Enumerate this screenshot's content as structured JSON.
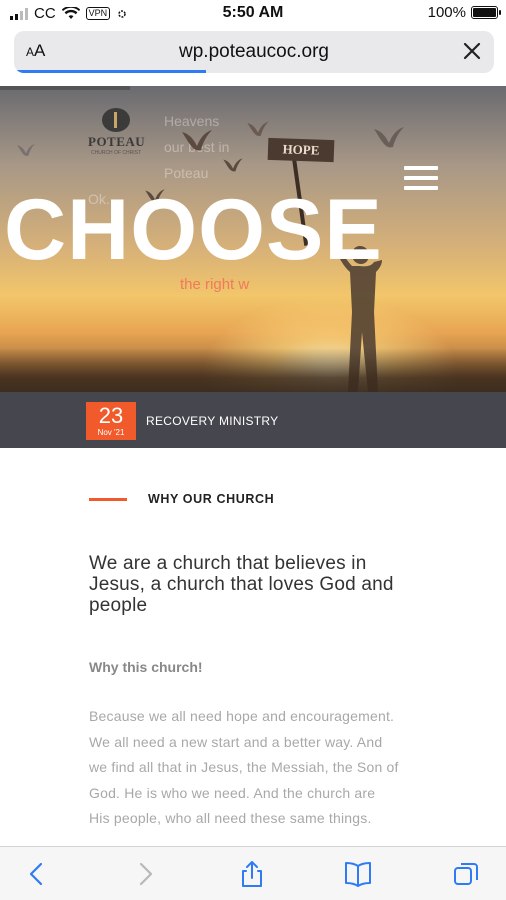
{
  "status_bar": {
    "carrier": "CC",
    "vpn": "VPN",
    "time": "5:50 AM",
    "battery": "100%"
  },
  "browser": {
    "text_size_label": "AA",
    "url": "wp.poteaucoc.org",
    "load_progress": 0.4
  },
  "hero": {
    "logo_text": "POTEAU",
    "logo_subtext": "CHURCH OF CHRIST",
    "faint_lines": [
      "Heavens",
      "our best in",
      "Poteau",
      "Ok."
    ],
    "sign_text": "HOPE",
    "headline": "CHOOSE",
    "tagline": "the right w",
    "event_day": "23",
    "event_month": "Nov '21",
    "event_title": "RECOVERY MINISTRY"
  },
  "content": {
    "section_label": "WHY OUR CHURCH",
    "lead": "We are a church that believes in Jesus, a church that loves God and people",
    "subhead": "Why this church!",
    "body": "Because we all need hope and encouragement. We all need a new start and a better way. And we find all that in Jesus, the Messiah, the Son of God. He is who we need. And the church are His people, who all need these same things."
  },
  "toolbar": {
    "back": "back-icon",
    "forward": "forward-icon",
    "share": "share-icon",
    "bookmarks": "book-icon",
    "tabs": "tabs-icon"
  },
  "colors": {
    "accent": "#f15a2b",
    "date_bar": "#46464e",
    "safari_blue": "#2f7bf5"
  }
}
